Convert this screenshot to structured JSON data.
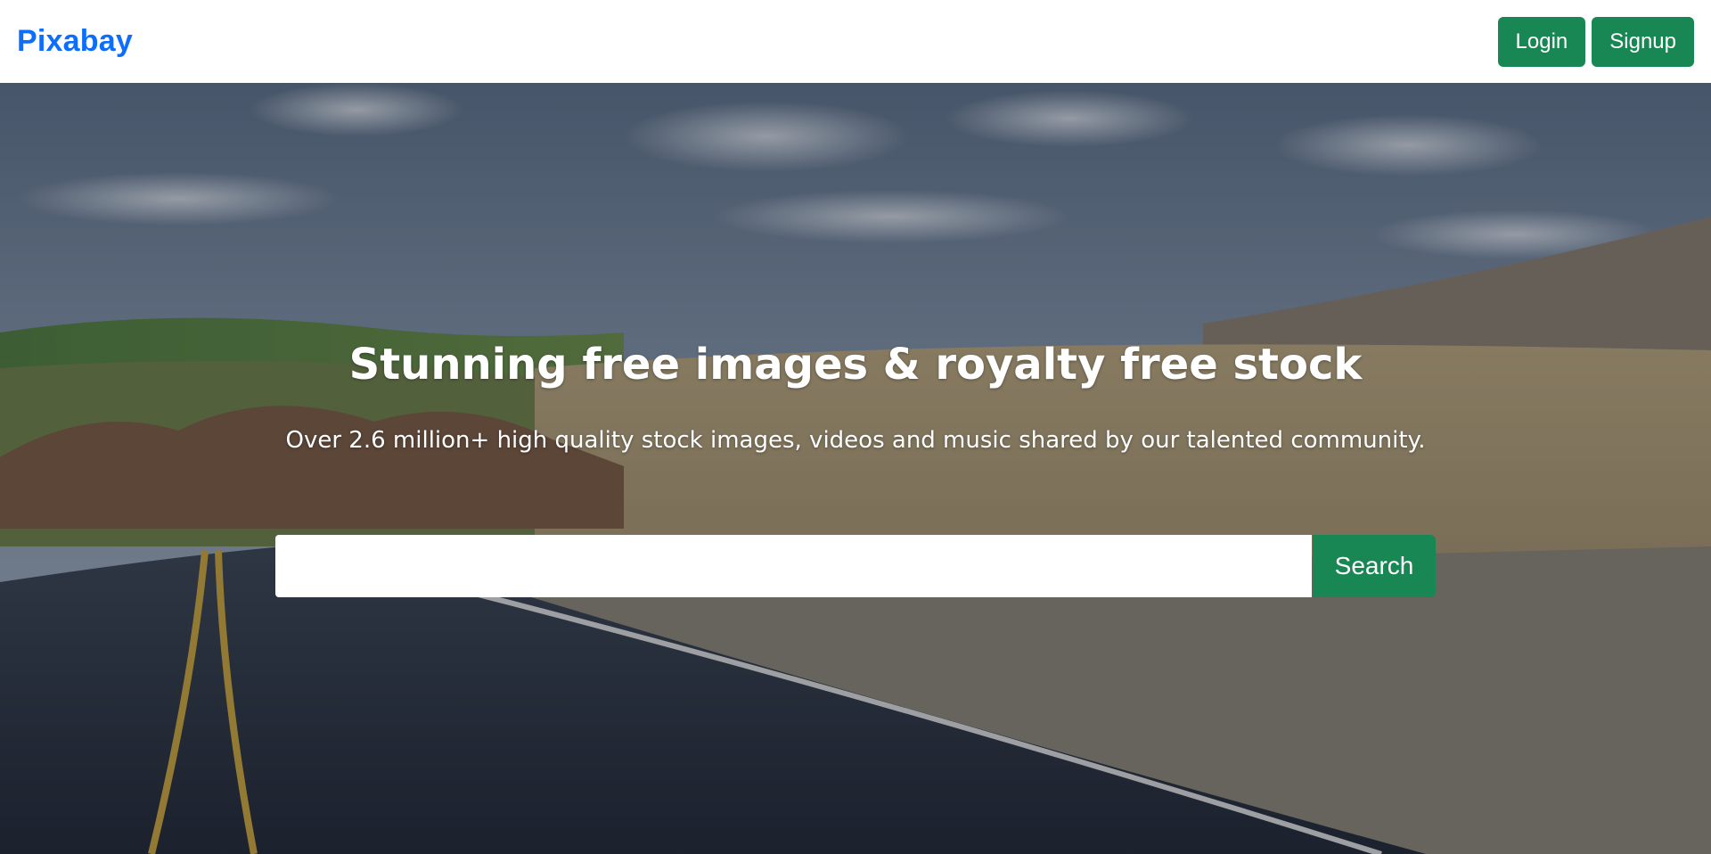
{
  "navbar": {
    "brand": "Pixabay",
    "login_label": "Login",
    "signup_label": "Signup"
  },
  "hero": {
    "title": "Stunning free images & royalty free stock",
    "subtitle": "Over 2.6 million+ high quality stock images, videos and music shared by our talented community.",
    "search_placeholder": "",
    "search_label": "Search"
  },
  "colors": {
    "brand": "#0d6efd",
    "button": "#198754"
  }
}
